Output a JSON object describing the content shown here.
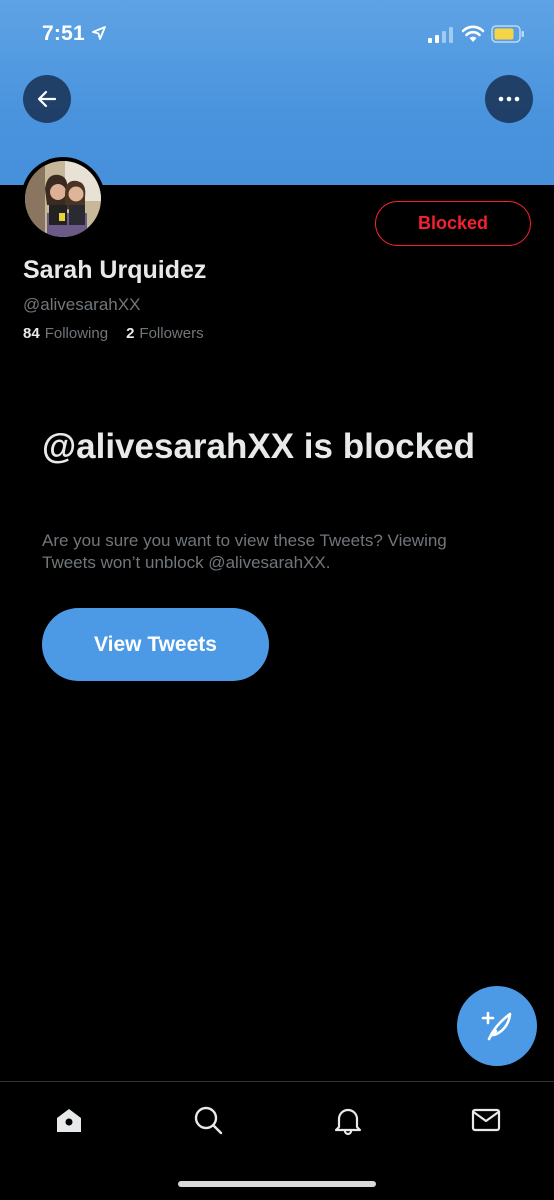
{
  "status_bar": {
    "time": "7:51"
  },
  "profile": {
    "display_name": "Sarah Urquidez",
    "handle": "@alivesarahXX",
    "following_count": "84",
    "following_label": "Following",
    "followers_count": "2",
    "followers_label": "Followers",
    "blocked_button_label": "Blocked"
  },
  "blocked_notice": {
    "title": "@alivesarahXX is blocked",
    "description": "Are you sure you want to view these Tweets? Viewing Tweets won’t unblock @alivesarahXX.",
    "button_label": "View Tweets"
  },
  "colors": {
    "banner": "#4a94de",
    "accent": "#4c9ae6",
    "blocked_red": "#f4212e",
    "background": "#000000",
    "secondary_text": "#71767b"
  },
  "icons": {
    "back": "arrow-left-icon",
    "more": "ellipsis-icon",
    "compose": "feather-plus-icon",
    "tabs": [
      "home-icon",
      "search-icon",
      "bell-icon",
      "envelope-icon"
    ]
  }
}
